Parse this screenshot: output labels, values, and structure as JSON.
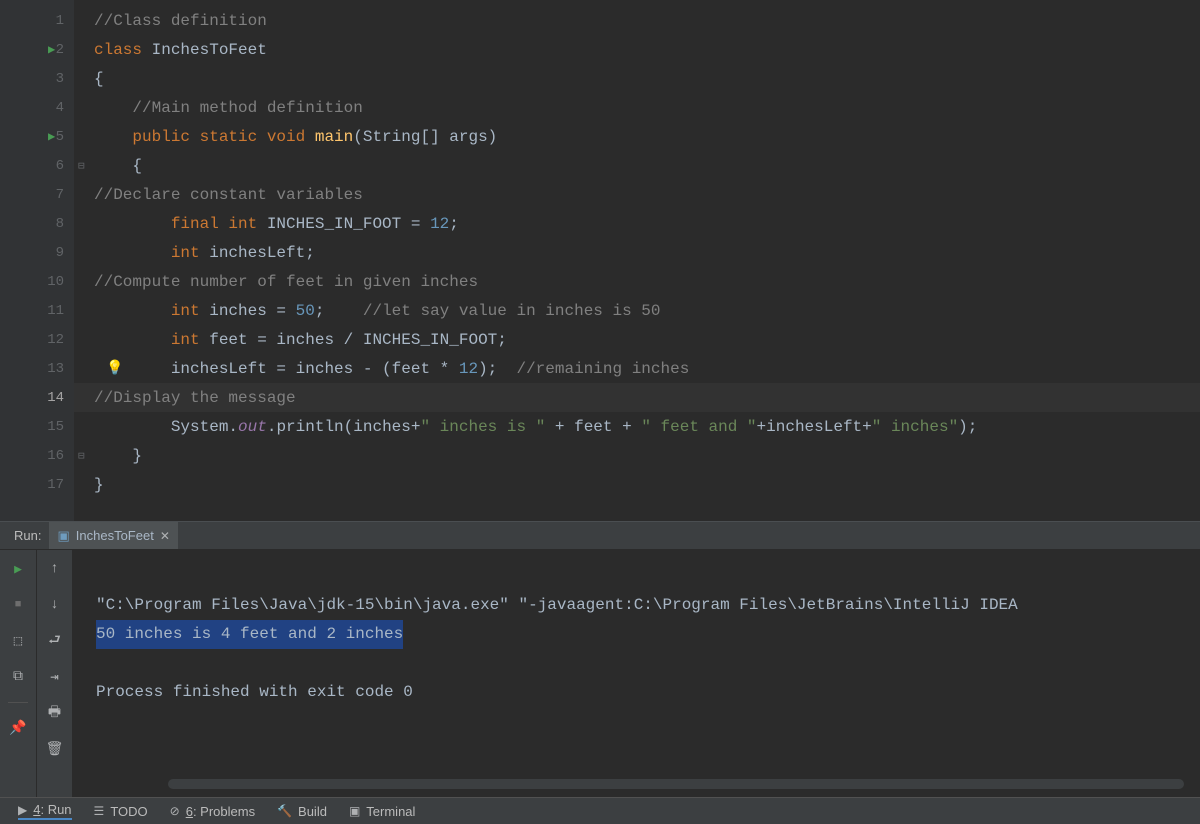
{
  "gutter": {
    "lines": [
      "1",
      "2",
      "3",
      "4",
      "5",
      "6",
      "7",
      "8",
      "9",
      "10",
      "11",
      "12",
      "13",
      "14",
      "15",
      "16",
      "17"
    ],
    "run_markers": [
      2,
      5
    ],
    "current": 14
  },
  "code": {
    "l1_comment": "//Class definition",
    "l2_kw": "class ",
    "l2_name": "InchesToFeet",
    "l3": "{",
    "l4_comment": "    //Main method definition",
    "l5_kw1": "    public static void ",
    "l5_method": "main",
    "l5_sig": "(String[] args)",
    "l6": "    {",
    "l7_comment": "//Declare constant variables",
    "l8_kw": "        final int ",
    "l8_var": "INCHES_IN_FOOT = ",
    "l8_num": "12",
    "l8_end": ";",
    "l9_kw": "        int ",
    "l9_var": "inchesLeft;",
    "l10_comment": "//Compute number of feet in given inches",
    "l11_kw": "        int ",
    "l11_var": "inches = ",
    "l11_num": "50",
    "l11_end": ";    ",
    "l11_com": "//let say value in inches is 50",
    "l12_kw": "        int ",
    "l12_var": "feet = inches / INCHES_IN_FOOT;",
    "l13_var": "        inchesLeft = inches - (feet * ",
    "l13_num": "12",
    "l13_end": ");  ",
    "l13_com": "//remaining inches",
    "l14_comment": "//Display the message",
    "l15_a": "        System.",
    "l15_out": "out",
    "l15_b": ".println(inches+",
    "l15_s1": "\" inches is \"",
    "l15_c": " + feet + ",
    "l15_s2": "\" feet and \"",
    "l15_d": "+inchesLeft+",
    "l15_s3": "\" inches\"",
    "l15_e": ");",
    "l16": "    }",
    "l17": "}"
  },
  "run": {
    "label": "Run:",
    "tab_name": "InchesToFeet",
    "console_cmd": "\"C:\\Program Files\\Java\\jdk-15\\bin\\java.exe\" \"-javaagent:C:\\Program Files\\JetBrains\\IntelliJ IDEA",
    "console_out": "50 inches is 4 feet and 2 inches",
    "console_exit": "Process finished with exit code 0"
  },
  "bottom": {
    "run": "4: Run",
    "todo": "TODO",
    "problems": "6: Problems",
    "build": "Build",
    "terminal": "Terminal"
  }
}
